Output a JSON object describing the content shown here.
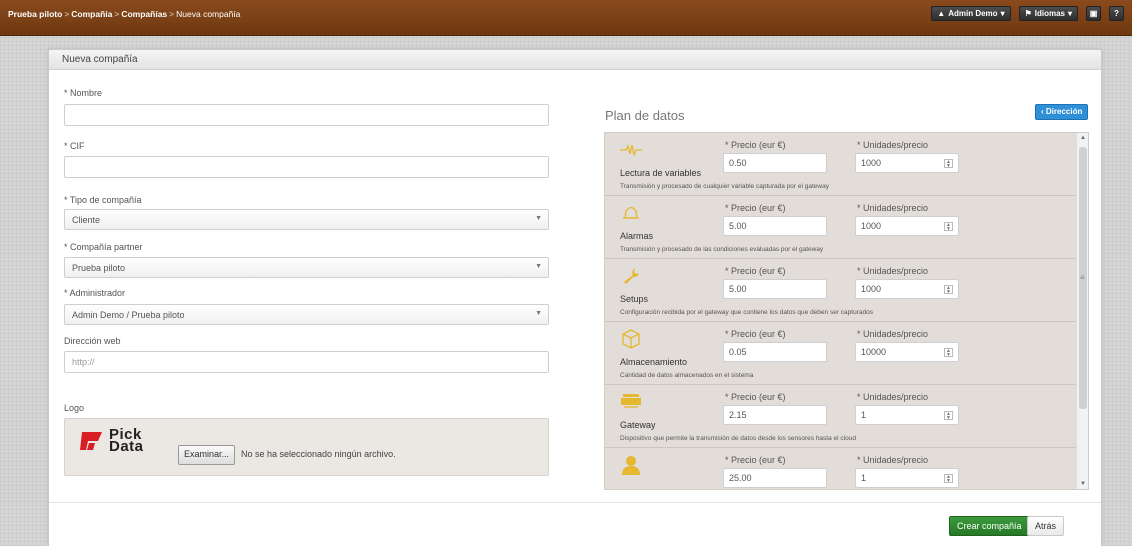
{
  "breadcrumb": {
    "items": [
      "Prueba piloto",
      "Compañía",
      "Compañías",
      "Nueva compañía"
    ],
    "sep": ">"
  },
  "topnav": {
    "user": "Admin Demo",
    "lang": "Idiomas"
  },
  "panel": {
    "title": "Nueva compañía"
  },
  "form": {
    "nombre_label": "* Nombre",
    "nombre_value": "",
    "cif_label": "* CIF",
    "cif_value": "",
    "tipo_label": "* Tipo de compañía",
    "tipo_value": "Cliente",
    "partner_label": "* Compañía partner",
    "partner_value": "Prueba piloto",
    "admin_label": "* Administrador",
    "admin_value": "Admin Demo / Prueba piloto",
    "web_label": "Dirección web",
    "web_placeholder": "http://",
    "logo_label": "Logo",
    "logo_text_top": "Pick",
    "logo_text_bottom": "Data",
    "browse_label": "Examinar...",
    "no_file": "No se ha seleccionado ningún archivo."
  },
  "plan": {
    "title": "Plan de datos",
    "direction_button": "‹ Dirección",
    "price_label": "* Precio (eur €)",
    "units_label": "* Unidades/precio",
    "rows": [
      {
        "icon": "waveform-icon",
        "name": "Lectura de variables",
        "price": "0.50",
        "units": "1000",
        "desc": "Transmisión y procesado de cualquier variable capturada por el gateway"
      },
      {
        "icon": "bell-icon",
        "name": "Alarmas",
        "price": "5.00",
        "units": "1000",
        "desc": "Transmisión y procesado de las condiciones evaluadas por el gateway"
      },
      {
        "icon": "wrench-icon",
        "name": "Setups",
        "price": "5.00",
        "units": "1000",
        "desc": "Configuración recibida por el gateway que contiene los datos que deben ser capturados"
      },
      {
        "icon": "box-icon",
        "name": "Almacenamiento",
        "price": "0.05",
        "units": "10000",
        "desc": "Cantidad de datos almacenados en el sistema"
      },
      {
        "icon": "router-icon",
        "name": "Gateway",
        "price": "2.15",
        "units": "1",
        "desc": "Dispositivo que permite la transmisión de datos desde los sensores hasta el cloud"
      },
      {
        "icon": "user-icon",
        "name": "",
        "price": "25.00",
        "units": "1",
        "desc": ""
      }
    ]
  },
  "footer": {
    "create": "Crear compañía",
    "back": "Atrás"
  }
}
